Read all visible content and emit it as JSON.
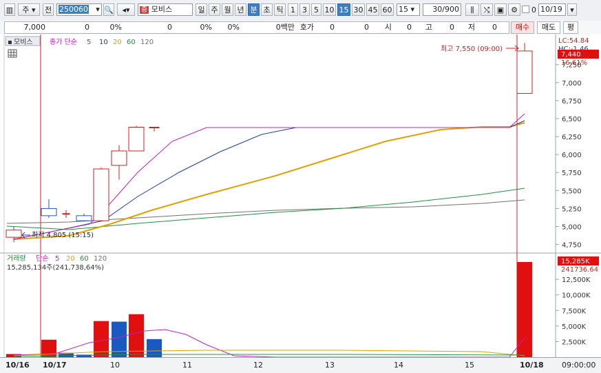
{
  "toolbar": {
    "mode1": "주",
    "mode2": "전",
    "code": "250060",
    "badge": "증",
    "stock_name": "모비스",
    "periods": [
      "일",
      "주",
      "월",
      "년",
      "분",
      "초",
      "틱"
    ],
    "selected_period": "분",
    "intervals": [
      "1",
      "3",
      "5",
      "10",
      "15",
      "30",
      "45",
      "60"
    ],
    "selected_interval": "15",
    "interval_select": "15",
    "count": "30",
    "count_total": "/900",
    "date_checkbox_label": "0",
    "date": "10/19"
  },
  "info_bar": {
    "price": "7,000",
    "v1": "0",
    "p1": "0%",
    "v2": "0",
    "p2": "0%",
    "p3": "0%",
    "unit": "0백만",
    "hoga_label": "호가",
    "hoga_v1": "0",
    "hoga_v2": "0",
    "si_label": "시",
    "si_value": "0",
    "go_label": "고",
    "go_value": "0",
    "jeo_label": "저",
    "jeo_value": "0",
    "buy": "매수",
    "sell": "매도",
    "eval": "평"
  },
  "price_panel": {
    "stock_tab": "모비스",
    "ma_label": "종가 단순",
    "ma_periods": [
      "5",
      "10",
      "20",
      "60",
      "120"
    ],
    "ma_colors": [
      "#c020c0",
      "#1a3aa8",
      "#e0a000",
      "#209040",
      "#707070"
    ],
    "high_label": "최고 7,550 (09:00)",
    "low_label": "최저 4,805 (15:15)",
    "lc_label": "LC:54.84",
    "hc_label": "HC:-1.46",
    "current_price": "7,440",
    "change_pct": "16.61%",
    "y_ticks": [
      "7,250",
      "7,000",
      "6,750",
      "6,500",
      "6,250",
      "6,000",
      "5,750",
      "5,500",
      "5,250",
      "5,000",
      "4,750"
    ]
  },
  "volume_panel": {
    "label": "거래량",
    "ma_label": "단순",
    "ma_periods": [
      "5",
      "20",
      "60",
      "120"
    ],
    "total": "15,285,134주(241,738,64%)",
    "current": "15,285K",
    "current_sub": "241736.64",
    "y_ticks": [
      "12,500K",
      "10,000K",
      "7,500K",
      "5,000K",
      "2,500K"
    ]
  },
  "x_axis": {
    "labels": [
      "10/16",
      "10/17",
      "10",
      "11",
      "12",
      "13",
      "14",
      "15",
      "10/18",
      "09:00:00"
    ]
  },
  "chart_data": {
    "type": "candlestick",
    "candles": [
      {
        "t": "10/16",
        "o": 4850,
        "h": 5000,
        "l": 4780,
        "c": 4950
      },
      {
        "t": "10/17 09:00",
        "o": 5250,
        "h": 5380,
        "l": 5120,
        "c": 5150
      },
      {
        "t": "09:15",
        "o": 5180,
        "h": 5230,
        "l": 5120,
        "c": 5180
      },
      {
        "t": "09:30",
        "o": 5150,
        "h": 5180,
        "l": 5070,
        "c": 5080
      },
      {
        "t": "09:45",
        "o": 5080,
        "h": 5820,
        "l": 5070,
        "c": 5800
      },
      {
        "t": "10:00",
        "o": 5850,
        "h": 6130,
        "l": 5650,
        "c": 6050
      },
      {
        "t": "10:15",
        "o": 6050,
        "h": 6400,
        "l": 6050,
        "c": 6380
      },
      {
        "t": "10:30",
        "o": 6380,
        "h": 6380,
        "l": 6320,
        "c": 6380
      },
      {
        "t": "10/18 09:00",
        "o": 6850,
        "h": 7550,
        "l": 6850,
        "c": 7440
      }
    ],
    "volumes": [
      {
        "t": "10/16",
        "v": 500,
        "dir": "up"
      },
      {
        "t": "10/17 09:00",
        "v": 2800,
        "dir": "up"
      },
      {
        "t": "09:15",
        "v": 700,
        "dir": "down"
      },
      {
        "t": "09:30",
        "v": 400,
        "dir": "down"
      },
      {
        "t": "09:45",
        "v": 5800,
        "dir": "up"
      },
      {
        "t": "10:00",
        "v": 5700,
        "dir": "down"
      },
      {
        "t": "10:15",
        "v": 6900,
        "dir": "up"
      },
      {
        "t": "10:30",
        "v": 2900,
        "dir": "down"
      },
      {
        "t": "10/18 09:00",
        "v": 15285,
        "dir": "up"
      }
    ],
    "price_range": [
      4650,
      7650
    ],
    "volume_range": [
      0,
      15285
    ]
  }
}
